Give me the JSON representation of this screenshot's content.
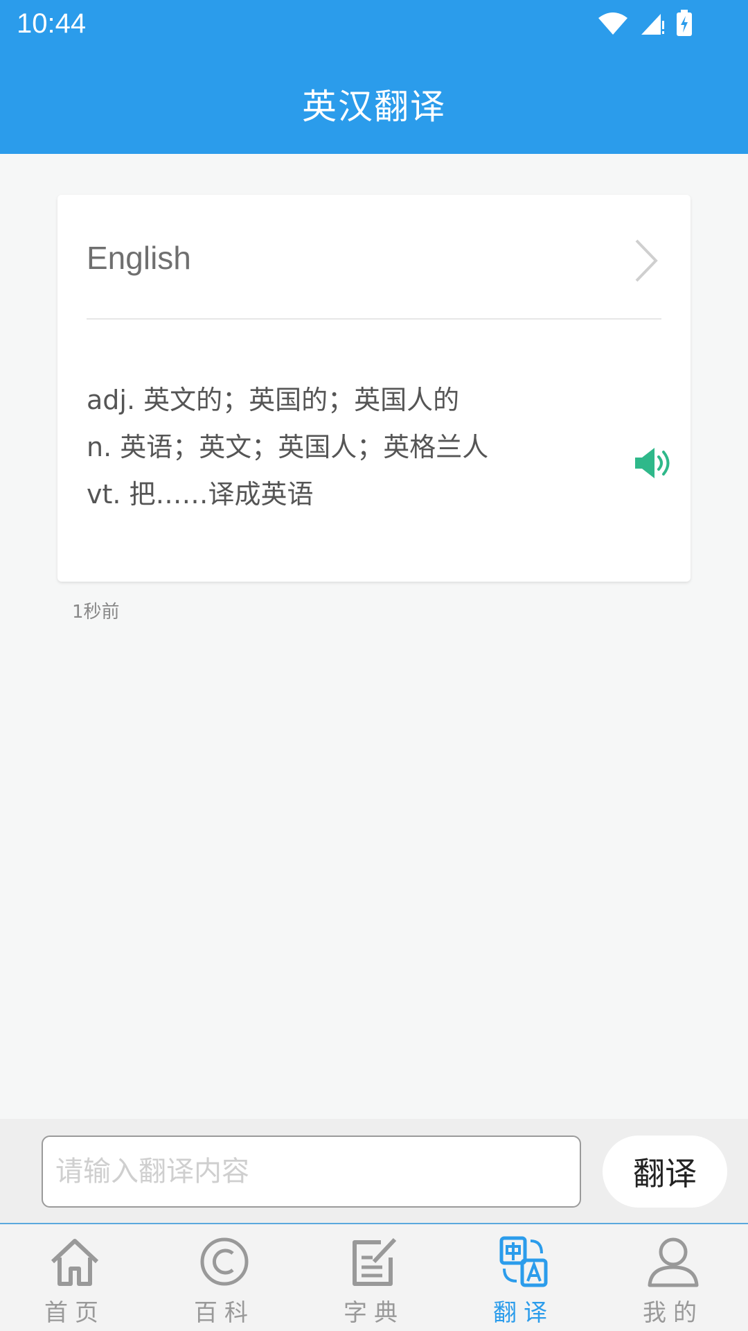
{
  "status_bar": {
    "time": "10:44"
  },
  "app_bar": {
    "title": "英汉翻译"
  },
  "result_card": {
    "word": "English",
    "definitions": [
      "adj. 英文的；英国的；英国人的",
      "n. 英语；英文；英国人；英格兰人",
      "vt. 把……译成英语"
    ],
    "timestamp": "1秒前"
  },
  "input_bar": {
    "placeholder": "请输入翻译内容",
    "value": "",
    "translate_button": "翻译"
  },
  "tabs": [
    {
      "label": "首页",
      "icon": "home-icon",
      "active": false
    },
    {
      "label": "百科",
      "icon": "copyright-icon",
      "active": false
    },
    {
      "label": "字典",
      "icon": "edit-document-icon",
      "active": false
    },
    {
      "label": "翻译",
      "icon": "translate-icon",
      "active": true
    },
    {
      "label": "我的",
      "icon": "user-icon",
      "active": false
    }
  ],
  "colors": {
    "primary": "#2b9ceb",
    "speaker": "#2fb88a",
    "inactive": "#999999"
  }
}
